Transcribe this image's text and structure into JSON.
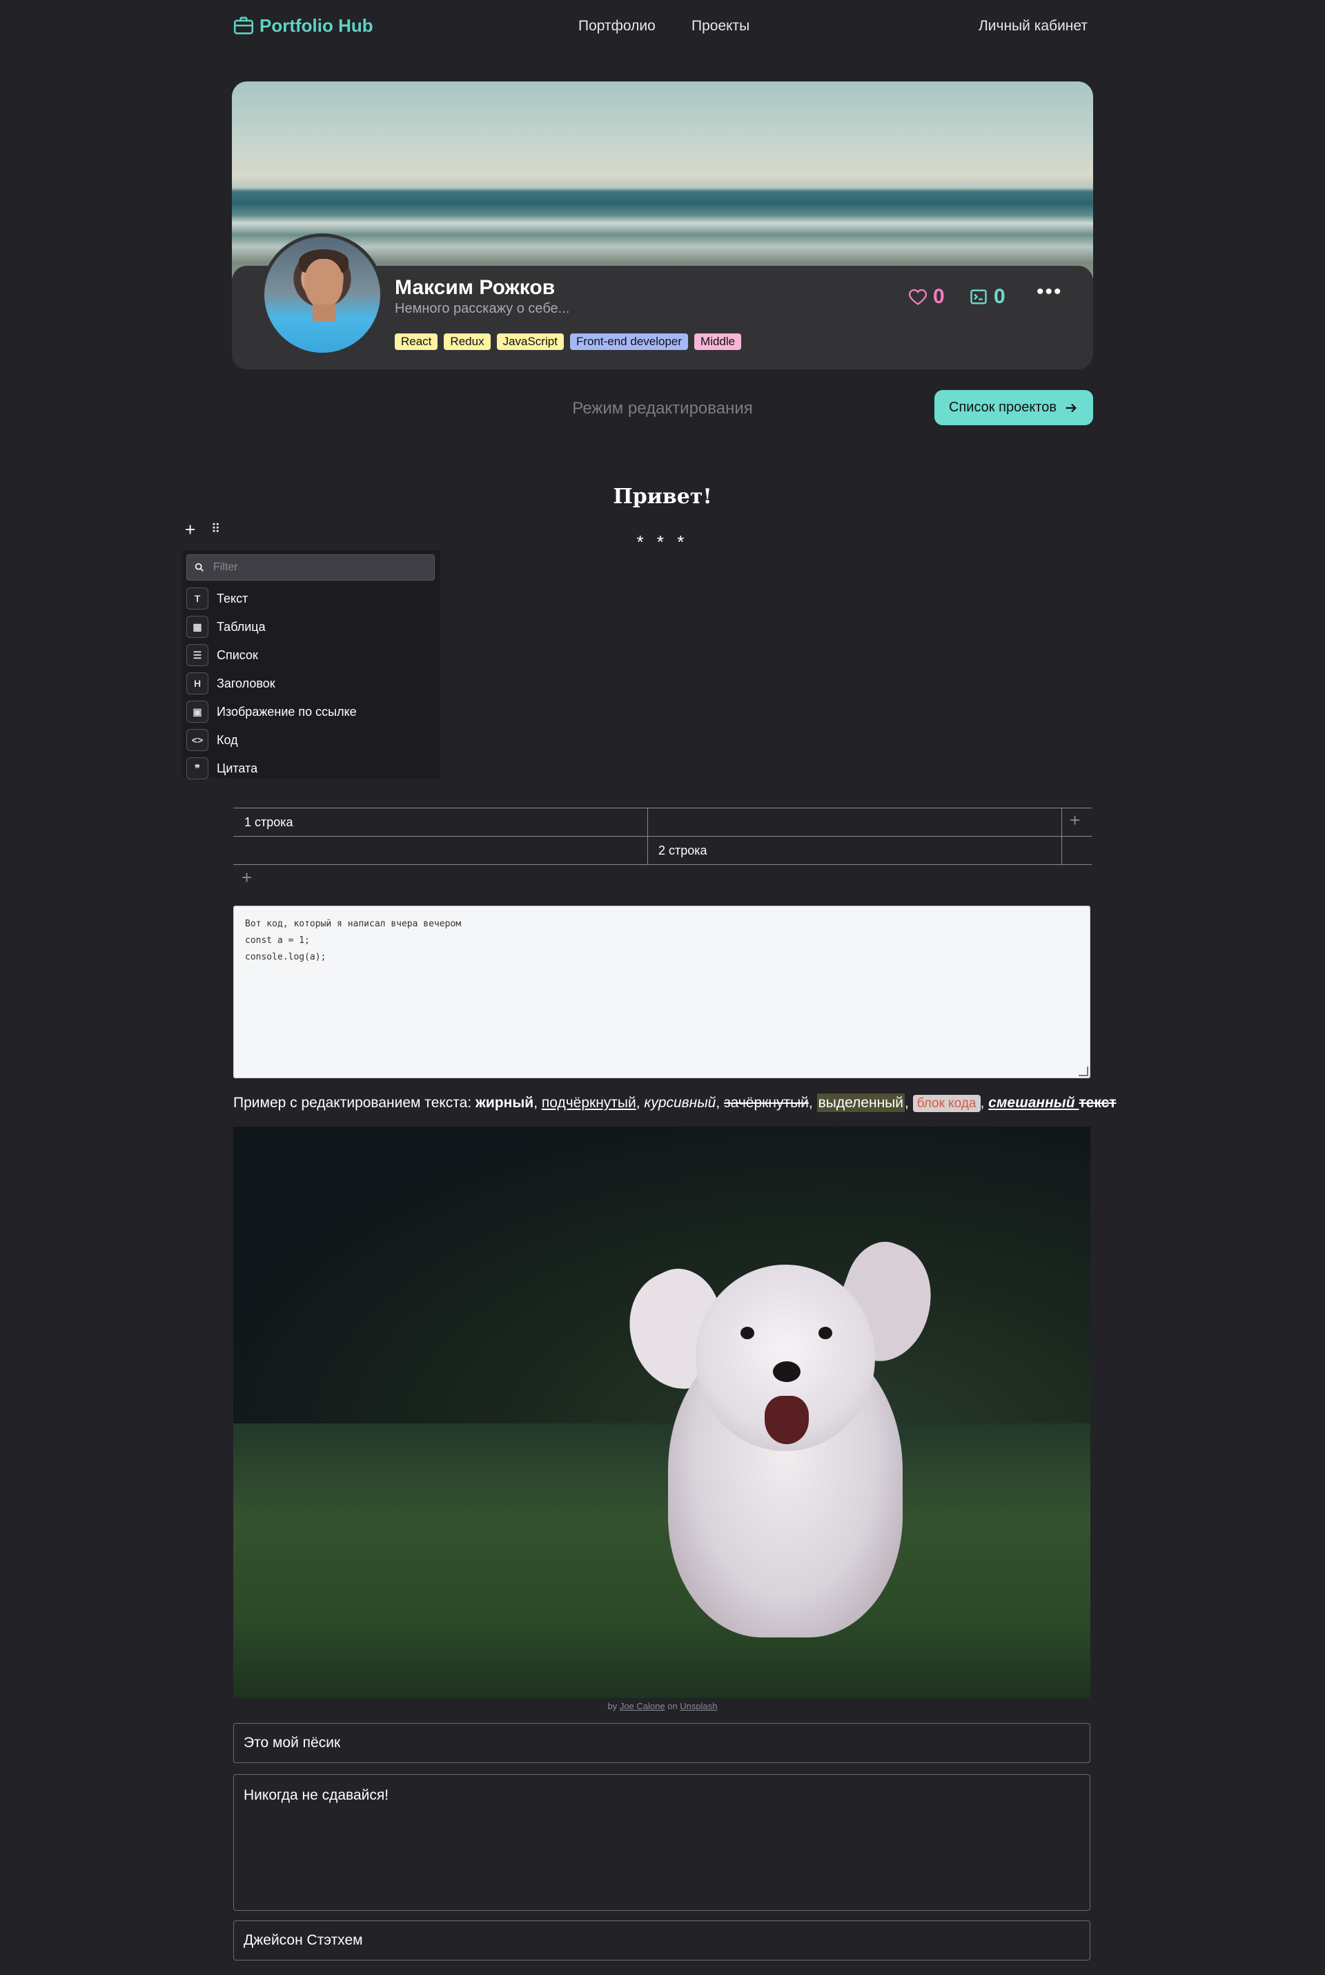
{
  "header": {
    "logo": "Portfolio Hub",
    "nav": [
      "Портфолио",
      "Проекты"
    ],
    "account": "Личный кабинет"
  },
  "profile": {
    "name": "Максим Рожков",
    "bio": "Немного расскажу о себе...",
    "tags": [
      {
        "label": "React",
        "color": "#fdf3a0"
      },
      {
        "label": "Redux",
        "color": "#fdf3a0"
      },
      {
        "label": "JavaScript",
        "color": "#fdf3a0"
      },
      {
        "label": "Front-end developer",
        "color": "#a5b8f5"
      },
      {
        "label": "Middle",
        "color": "#f7b6d7"
      }
    ],
    "likes": "0",
    "projects_count": "0",
    "like_color": "#f07fbf",
    "accent": "#6fdcd0"
  },
  "toolbar": {
    "mode_label": "Режим редактирования",
    "projects_button": "Список проектов"
  },
  "editor": {
    "heading": "Привет!",
    "delimiter": "* * *",
    "menu": {
      "filter_placeholder": "Filter",
      "items": [
        {
          "label": "Текст",
          "icon": "T"
        },
        {
          "label": "Таблица",
          "icon": "▦"
        },
        {
          "label": "Список",
          "icon": "☰"
        },
        {
          "label": "Заголовок",
          "icon": "H"
        },
        {
          "label": "Изображение по ссылке",
          "icon": "▣"
        },
        {
          "label": "Код",
          "icon": "<>"
        },
        {
          "label": "Цитата",
          "icon": "❞"
        }
      ]
    },
    "table": {
      "rows": [
        [
          "1 строка",
          ""
        ],
        [
          "",
          "2 строка"
        ]
      ]
    },
    "code": [
      "Вот код, который я написал вчера вечером",
      "const a = 1;",
      "console.log(a);"
    ],
    "rich_text": {
      "prefix": "Пример с редактированием текста: ",
      "bold": "жирный",
      "underline": "подчёркнутый",
      "italic": "курсивный",
      "strike": "зачёркнутый",
      "marked": "выделенный",
      "inline_code": "блок кода",
      "mixed": "смешанный ",
      "mixed_strike": "текст"
    },
    "image_caption": {
      "by": "by ",
      "author": "Joe Calone",
      "on": " on ",
      "source": "Unsplash"
    },
    "quote_caption": "Это мой пёсик",
    "quote_text": "Никогда не сдавайся!",
    "quote_author": "Джейсон Стэтхем"
  }
}
